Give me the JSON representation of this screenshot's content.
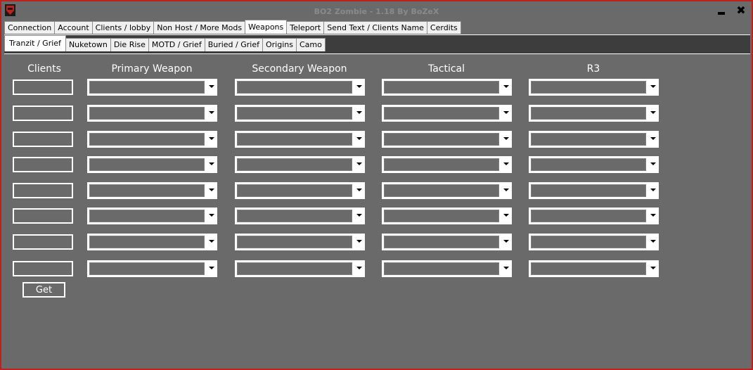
{
  "window": {
    "title": "BO2 Zombie - 1.18 By BoZeX",
    "minimize_icon": "minimize-icon",
    "close_label": "✖"
  },
  "main_tabs": [
    {
      "label": "Connection",
      "active": false
    },
    {
      "label": "Account",
      "active": false
    },
    {
      "label": "Clients / lobby",
      "active": false
    },
    {
      "label": "Non Host / More Mods",
      "active": false
    },
    {
      "label": "Weapons",
      "active": true
    },
    {
      "label": "Teleport",
      "active": false
    },
    {
      "label": "Send Text  / Clients Name",
      "active": false
    },
    {
      "label": "Cerdits",
      "active": false
    }
  ],
  "sub_tabs": [
    {
      "label": "Tranzit / Grief",
      "active": true
    },
    {
      "label": "Nuketown",
      "active": false
    },
    {
      "label": "Die Rise",
      "active": false
    },
    {
      "label": "MOTD / Grief",
      "active": false
    },
    {
      "label": "Buried / Grief",
      "active": false
    },
    {
      "label": "Origins",
      "active": false
    },
    {
      "label": "Camo",
      "active": false
    }
  ],
  "columns": {
    "clients": "Clients",
    "primary": "Primary Weapon",
    "secondary": "Secondary Weapon",
    "tactical": "Tactical",
    "r3": "R3"
  },
  "row_count": 8,
  "get_button": "Get",
  "colors": {
    "border_accent": "#c0201c",
    "background": "#6a6a6a",
    "subtab_strip": "#3d3d3d"
  }
}
